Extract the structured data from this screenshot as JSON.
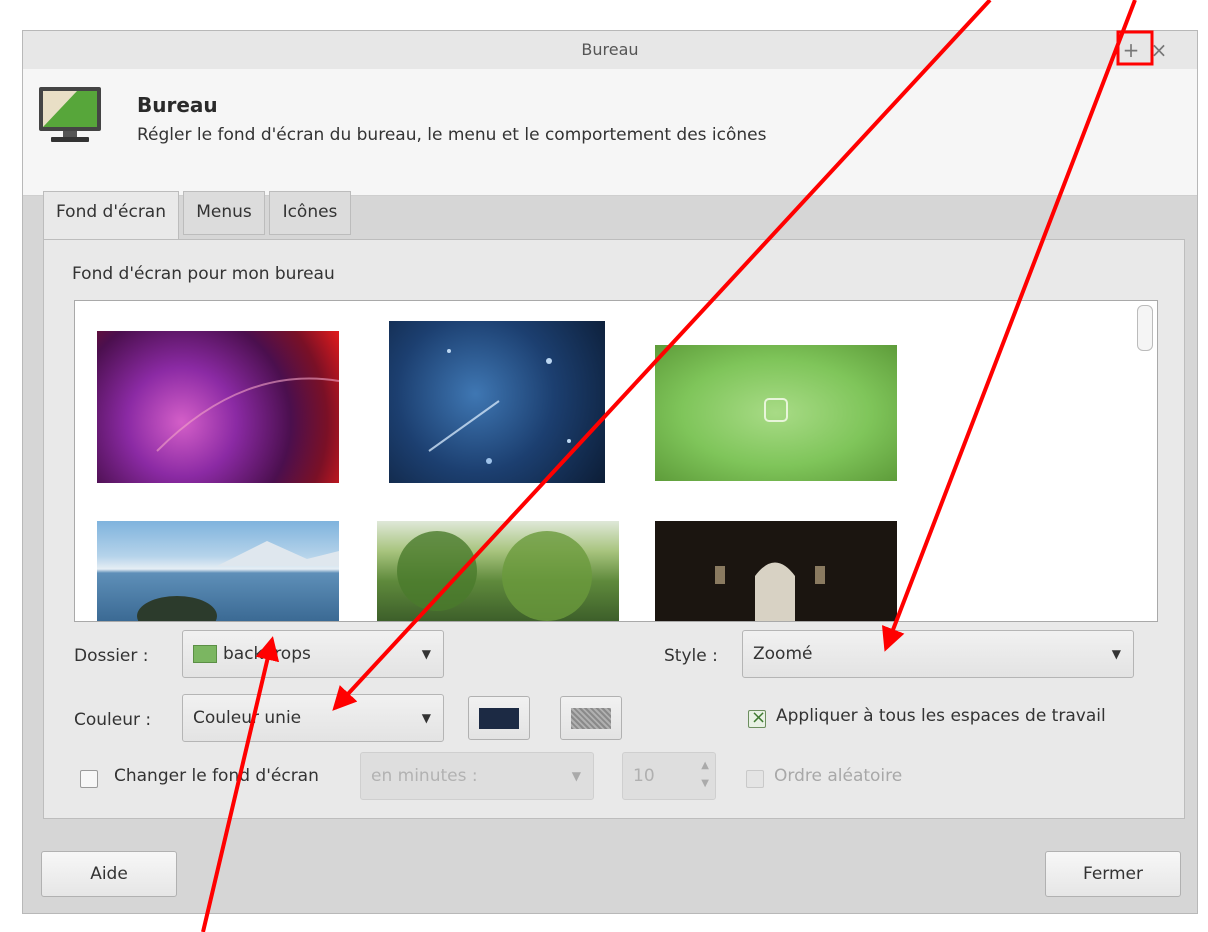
{
  "window": {
    "title": "Bureau",
    "maximize_glyph": "+",
    "close_glyph": "×"
  },
  "header": {
    "title": "Bureau",
    "subtitle": "Régler le fond d'écran du bureau, le menu et le comportement des icônes",
    "icon": "desktop-monitor-icon"
  },
  "tabs": [
    {
      "label": "Fond d'écran",
      "active": true
    },
    {
      "label": "Menus",
      "active": false
    },
    {
      "label": "Icônes",
      "active": false
    }
  ],
  "wallpaper": {
    "section_label": "Fond d'écran pour mon bureau",
    "thumbnails": [
      {
        "name": "purple-abstract"
      },
      {
        "name": "blue-space"
      },
      {
        "name": "green-mint-logo"
      },
      {
        "name": "lake-mountains"
      },
      {
        "name": "trees-park"
      },
      {
        "name": "dark-archway"
      }
    ]
  },
  "controls": {
    "folder_label": "Dossier :",
    "folder_value": "backdrops",
    "style_label": "Style :",
    "style_value": "Zoomé",
    "color_label": "Couleur :",
    "color_value": "Couleur unie",
    "primary_color": "#1c2a44",
    "apply_all_label": "Appliquer à tous les espaces de travail",
    "apply_all_checked": true,
    "change_label": "Changer le fond d'écran",
    "change_checked": false,
    "interval_placeholder": "en minutes :",
    "interval_value": "10",
    "random_label": "Ordre aléatoire",
    "random_checked": false
  },
  "footer": {
    "help_label": "Aide",
    "close_label": "Fermer"
  },
  "annotation": {
    "arrow_color": "#ff0000"
  }
}
